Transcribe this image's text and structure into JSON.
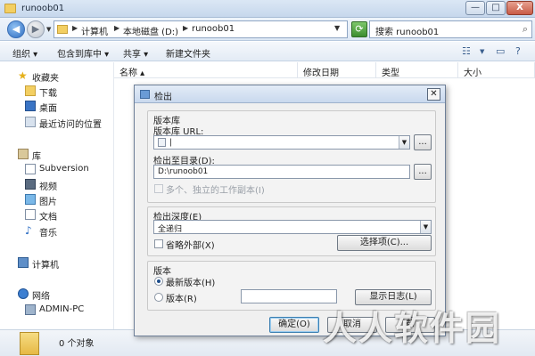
{
  "window": {
    "title": "runoob01",
    "controls": {
      "minimize": "—",
      "maximize": "□",
      "close": "X"
    }
  },
  "address_bar": {
    "crumbs": [
      "计算机",
      "本地磁盘 (D:)",
      "runoob01"
    ],
    "search_placeholder": "搜索 runoob01"
  },
  "toolbar": {
    "organize": "组织 ▾",
    "include_library": "包含到库中 ▾",
    "share": "共享 ▾",
    "new_folder": "新建文件夹"
  },
  "columns": [
    "名称",
    "修改日期",
    "类型",
    "大小"
  ],
  "nav": {
    "favorites": "收藏夹",
    "downloads": "下载",
    "desktop": "桌面",
    "recent": "最近访问的位置",
    "libraries": "库",
    "subversion": "Subversion",
    "videos": "视频",
    "pictures": "图片",
    "documents": "文档",
    "music": "音乐",
    "computer": "计算机",
    "network": "网络",
    "host": "ADMIN-PC"
  },
  "status": {
    "count": "0 个对象"
  },
  "dialog": {
    "title": "检出",
    "repo_group": "版本库",
    "repo_url_label": "版本库 URL:",
    "repo_url_value": "|",
    "checkout_dir_label": "检出至目录(D):",
    "checkout_dir_value": "D:\\runoob01",
    "multi_label": "多个、独立的工作副本(I)",
    "browse": "...",
    "depth_group": "检出深度(E)",
    "depth_value": "全递归",
    "omit_externals": "省略外部(X)",
    "options_button": "选择项(C)...",
    "revision_group": "版本",
    "head_revision": "最新版本(H)",
    "revision": "版本(R)",
    "revision_value": "",
    "show_log": "显示日志(L)",
    "ok": "确定(O)",
    "cancel": "取消",
    "help": "帮"
  },
  "watermark": "人人软件园"
}
